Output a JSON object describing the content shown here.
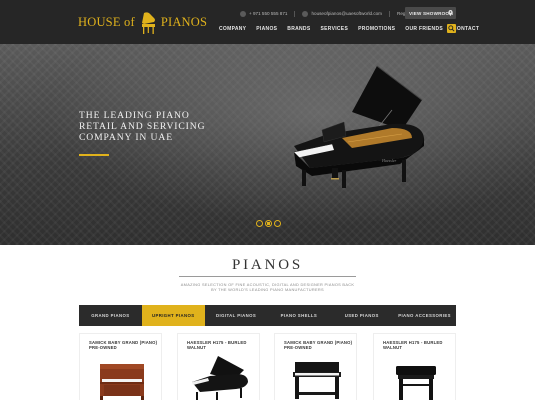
{
  "header": {
    "logo_left": "HOUSE of",
    "logo_right": "PIANOS",
    "phone": "+ 971 550 555 871",
    "email": "houseofpianos@uaesoftworld.com",
    "register": "Register",
    "login": "Login",
    "showroom_button": "VIEW SHOWROOM",
    "nav": [
      "COMPANY",
      "PIANOS",
      "BRANDS",
      "SERVICES",
      "PROMOTIONS",
      "OUR FRIENDS",
      "CONTACT"
    ]
  },
  "hero": {
    "title_line1": "THE LEADING PIANO",
    "title_line2": "RETAIL AND SERVICING",
    "title_line3": "COMPANY IN UAE",
    "slides": 3,
    "active_slide": 2
  },
  "pianos_section": {
    "title": "PIANOS",
    "subtitle_line1": "AMAZING SELECTION OF FINE ACOUSTIC, DIGITAL AND DESIGNER PIANOS BACK",
    "subtitle_line2": "BY THE WORLD'S LEADING PIANO MANUFACTURERS",
    "tabs": [
      "GRAND PIANOS",
      "UPRIGHT PIANOS",
      "DIGITAL PIANOS",
      "PIANO SHELLS",
      "USED PIANOS",
      "PIANO ACCESSORIES"
    ],
    "active_tab": 1,
    "products": [
      {
        "title": "SAMICK BABY GRAND (PIANO) PRE-OWNED"
      },
      {
        "title": "HAESSLER H175 - BURLED WALNUT"
      },
      {
        "title": "SAMICK BABY GRAND (PIANO) PRE-OWNED"
      },
      {
        "title": "HAESSLER H175 - BURLED WALNUT"
      }
    ]
  },
  "colors": {
    "accent": "#e0b21c",
    "header_bg": "#262626",
    "tabs_bg": "#2b2b2b"
  },
  "icons": [
    "piano-logo-icon",
    "phone-icon",
    "mail-icon",
    "map-pin-icon",
    "search-icon"
  ]
}
